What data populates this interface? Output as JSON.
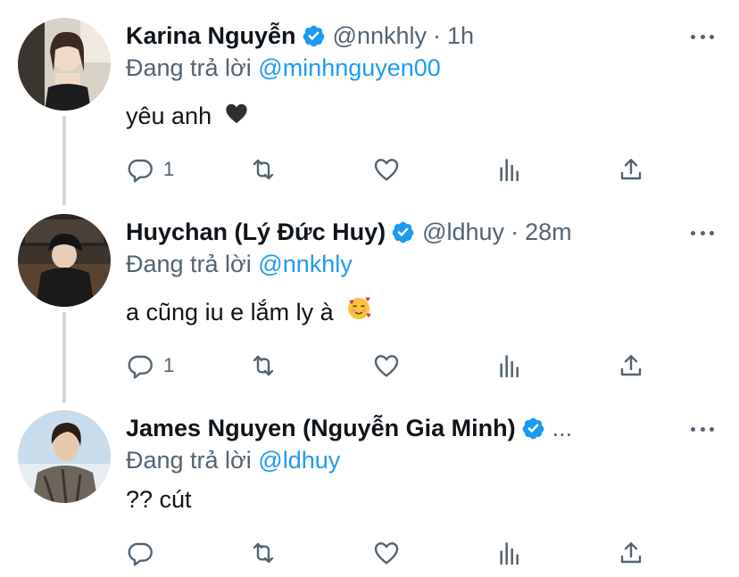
{
  "colors": {
    "accent": "#1d9bf0",
    "muted": "#536471",
    "text": "#0f1419",
    "thread_line": "#cfd9de"
  },
  "tweets": [
    {
      "name": "Karina Nguyễn",
      "verified": true,
      "handle": "@nnkhly",
      "separator": "·",
      "time": "1h",
      "reply_prefix": "Đang trả lời",
      "reply_to": "@minhnguyen00",
      "text": "yêu anh",
      "emoji": "🖤",
      "reply_count": "1",
      "icons": [
        "reply-icon",
        "retweet-icon",
        "like-icon",
        "analytics-icon",
        "share-icon"
      ]
    },
    {
      "name": "Huychan (Lý Đức Huy)",
      "verified": true,
      "handle": "@ldhuy",
      "separator": "·",
      "time": "28m",
      "reply_prefix": "Đang trả lời",
      "reply_to": "@nnkhly",
      "text": "a cũng iu e lắm ly à",
      "emoji": "🥰",
      "reply_count": "1",
      "icons": [
        "reply-icon",
        "retweet-icon",
        "like-icon",
        "analytics-icon",
        "share-icon"
      ]
    },
    {
      "name": "James Nguyen (Nguyễn Gia Minh)",
      "verified": true,
      "handle_truncated": "...",
      "reply_prefix": "Đang trả lời",
      "reply_to": "@ldhuy",
      "text": "?? cút",
      "reply_count": "",
      "icons": [
        "reply-icon",
        "retweet-icon",
        "like-icon",
        "analytics-icon",
        "share-icon"
      ]
    }
  ]
}
